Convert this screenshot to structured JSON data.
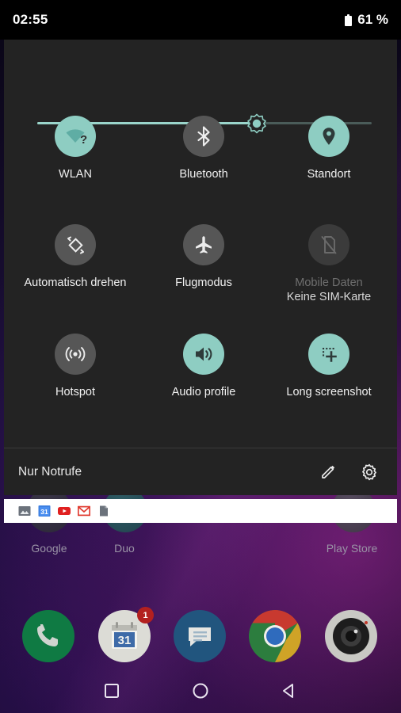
{
  "status_bar": {
    "clock": "02:55",
    "battery_text": "61 %",
    "battery_icon": "battery-icon"
  },
  "quick_settings": {
    "brightness": {
      "name": "brightness-slider",
      "value_percent": 62,
      "thumb_icon": "brightness-sun-icon"
    },
    "tiles": [
      {
        "id": "wlan",
        "label": "WLAN",
        "sublabel": "",
        "state": "on",
        "icon": "wifi-question-icon"
      },
      {
        "id": "bluetooth",
        "label": "Bluetooth",
        "sublabel": "",
        "state": "off",
        "icon": "bluetooth-icon"
      },
      {
        "id": "standort",
        "label": "Standort",
        "sublabel": "",
        "state": "on",
        "icon": "location-pin-icon"
      },
      {
        "id": "auto-rotate",
        "label": "Automatisch drehen",
        "sublabel": "",
        "state": "off",
        "icon": "screen-rotate-icon"
      },
      {
        "id": "flugmodus",
        "label": "Flugmodus",
        "sublabel": "",
        "state": "off",
        "icon": "airplane-icon"
      },
      {
        "id": "mobile-daten",
        "label": "Mobile Daten",
        "sublabel": "Keine SIM-Karte",
        "state": "disabled",
        "icon": "no-sim-icon"
      },
      {
        "id": "hotspot",
        "label": "Hotspot",
        "sublabel": "",
        "state": "off",
        "icon": "hotspot-icon"
      },
      {
        "id": "audio-profile",
        "label": "Audio profile",
        "sublabel": "",
        "state": "on",
        "icon": "speaker-volume-icon"
      },
      {
        "id": "long-screenshot",
        "label": "Long screenshot",
        "sublabel": "",
        "state": "on",
        "icon": "long-screenshot-icon"
      }
    ],
    "footer": {
      "carrier": "Nur Notrufe",
      "edit_icon": "pencil-edit-icon",
      "settings_icon": "gear-settings-icon"
    }
  },
  "notification_strip": {
    "icons": [
      {
        "id": "photos",
        "name": "image-icon"
      },
      {
        "id": "calendar",
        "name": "calendar-icon",
        "day": "31"
      },
      {
        "id": "youtube",
        "name": "youtube-icon"
      },
      {
        "id": "gmail",
        "name": "gmail-icon"
      },
      {
        "id": "sdcard",
        "name": "sd-card-icon"
      }
    ]
  },
  "home_screen": {
    "app_labels": [
      {
        "id": "google",
        "label": "Google"
      },
      {
        "id": "duo",
        "label": "Duo"
      },
      {
        "id": "playstore",
        "label": "Play Store"
      }
    ],
    "dock": [
      {
        "id": "phone",
        "name": "phone-icon",
        "badge": ""
      },
      {
        "id": "calendar",
        "name": "calendar-icon",
        "badge": "1",
        "day": "31"
      },
      {
        "id": "messages",
        "name": "messages-icon",
        "badge": ""
      },
      {
        "id": "chrome",
        "name": "chrome-icon",
        "badge": ""
      },
      {
        "id": "camera",
        "name": "camera-icon",
        "badge": ""
      }
    ]
  },
  "nav_bar": {
    "buttons": [
      {
        "id": "recents",
        "name": "recents-square-icon"
      },
      {
        "id": "home",
        "name": "home-circle-icon"
      },
      {
        "id": "back",
        "name": "back-triangle-icon"
      }
    ]
  },
  "colors": {
    "accent_teal": "#8ecdc2",
    "panel_bg": "#232323",
    "tile_off": "#565656",
    "tile_disabled": "#3b3b3b",
    "status_bg": "#000000"
  }
}
